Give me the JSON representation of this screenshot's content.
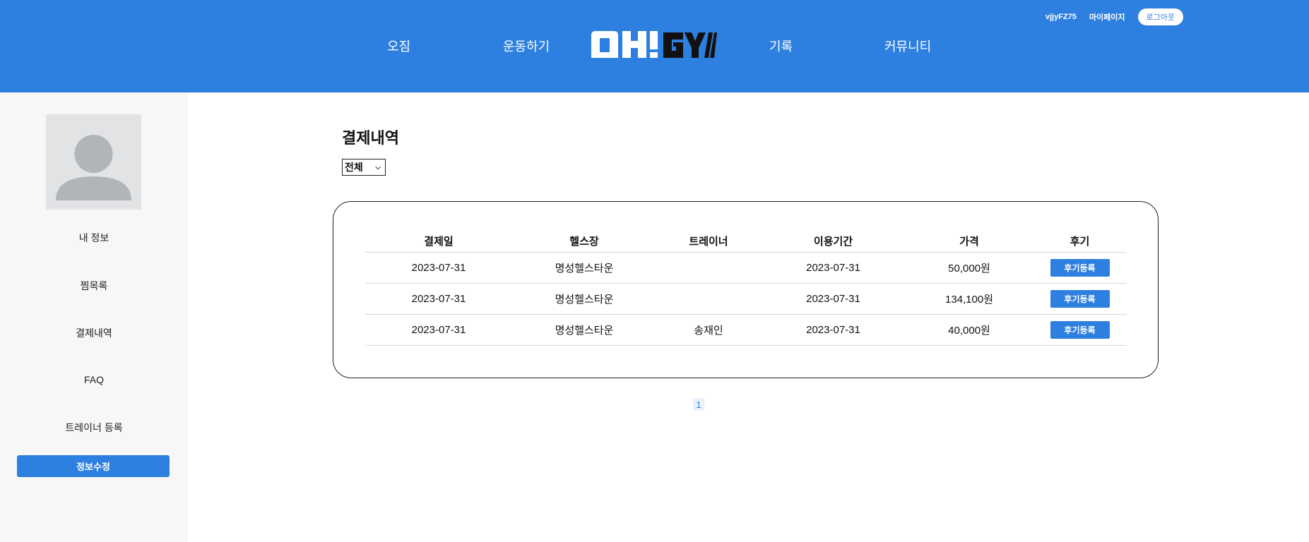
{
  "header": {
    "username": "vjjyFZ75",
    "mypage_label": "마이페이지",
    "logout_label": "로그아웃",
    "nav": [
      "오짐",
      "운동하기",
      "기록",
      "커뮤니티"
    ],
    "logo_text": "OH!GYM"
  },
  "sidebar": {
    "items": [
      "내 정보",
      "찜목록",
      "결제내역",
      "FAQ",
      "트레이너 등록"
    ],
    "edit_button": "정보수정"
  },
  "main": {
    "title": "결제내역",
    "filter_selected": "전체",
    "table": {
      "columns": [
        "결제일",
        "헬스장",
        "트레이너",
        "이용기간",
        "가격",
        "후기"
      ],
      "rows": [
        {
          "date": "2023-07-31",
          "gym": "명성헬스타운",
          "trainer": "",
          "period": "2023-07-31",
          "price": "50,000원",
          "review": "후기등록"
        },
        {
          "date": "2023-07-31",
          "gym": "명성헬스타운",
          "trainer": "",
          "period": "2023-07-31",
          "price": "134,100원",
          "review": "후기등록"
        },
        {
          "date": "2023-07-31",
          "gym": "명성헬스타운",
          "trainer": "송재인",
          "period": "2023-07-31",
          "price": "40,000원",
          "review": "후기등록"
        }
      ]
    },
    "pagination": [
      "1"
    ]
  },
  "colors": {
    "brand_blue": "#2e80e0",
    "sidebar_bg": "#f7f7f7",
    "avatar_bg": "#e2e3e5",
    "avatar_fg": "#b1b5b9"
  }
}
